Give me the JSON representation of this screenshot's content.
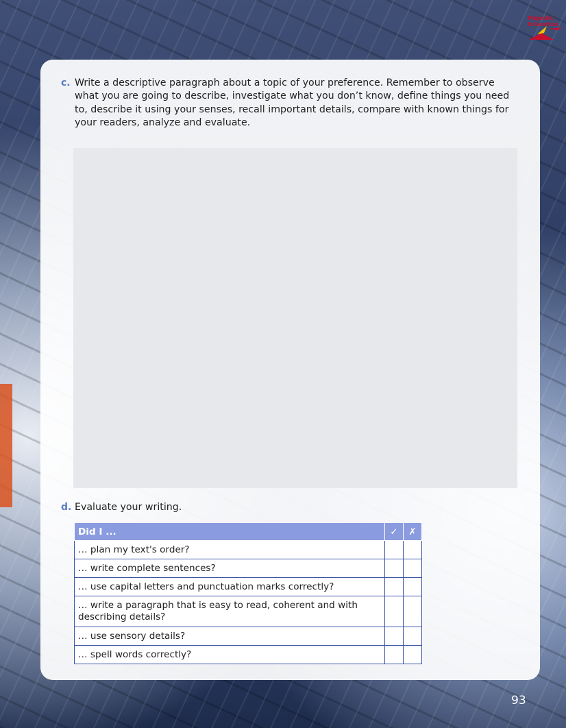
{
  "logo": {
    "line1": "Majestic",
    "line2": "Education"
  },
  "question_c": {
    "letter": "c.",
    "lines": [
      "Write a descriptive paragraph about a topic of your preference. Remember to observe",
      "what you are going to describe, investigate what you don’t know, define things you need",
      "to, describe it using your senses, recall important details, compare with known things for",
      "your readers, analyze and evaluate."
    ]
  },
  "question_d": {
    "letter": "d.",
    "text": "Evaluate your writing."
  },
  "eval_table": {
    "header": "Did I ...",
    "check_symbol": "✓",
    "cross_symbol": "✗",
    "rows": [
      "… plan my text's order?",
      "… write complete sentences?",
      "… use capital letters and punctuation marks correctly?",
      "… write a paragraph that is easy to read, coherent and with describing details?",
      "… use sensory details?",
      "… spell words correctly?"
    ]
  },
  "page_number": "93"
}
